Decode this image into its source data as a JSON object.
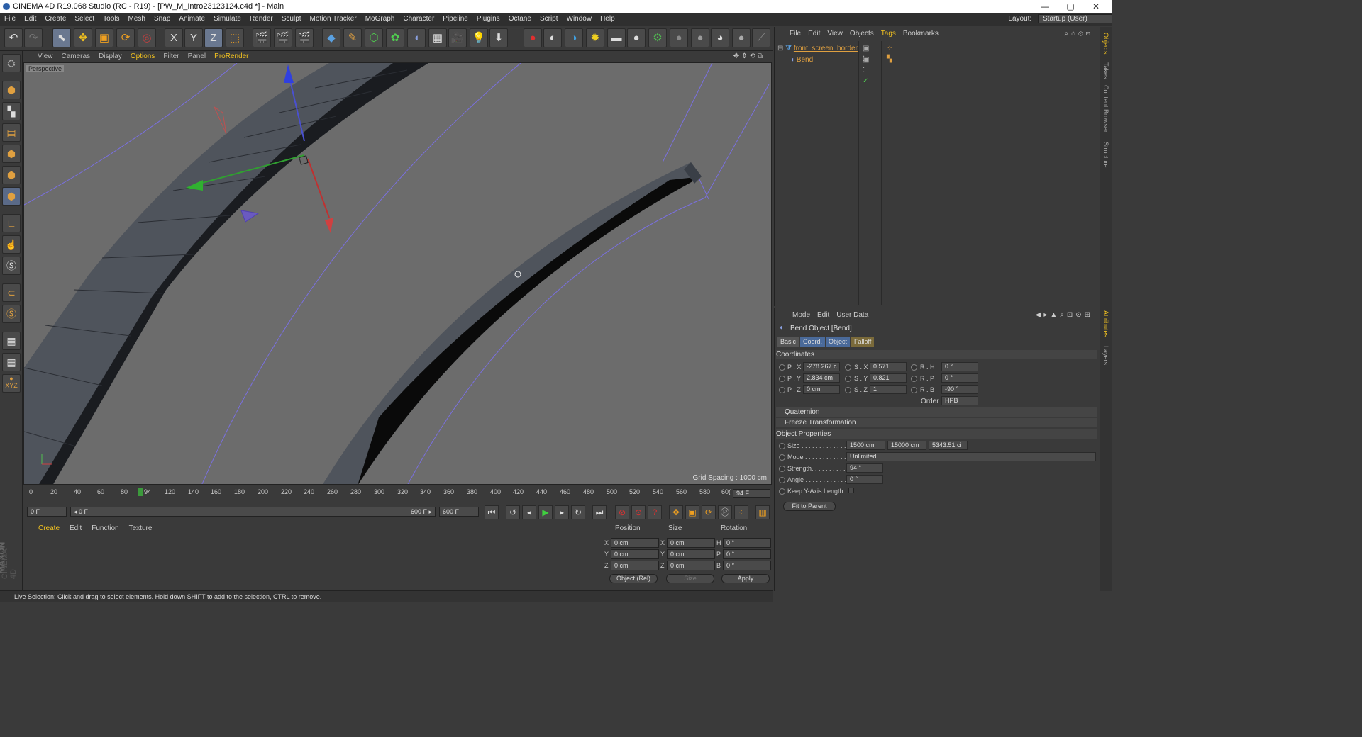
{
  "window": {
    "title": "CINEMA 4D R19.068 Studio (RC - R19) - [PW_M_Intro23123124.c4d *] - Main",
    "minimize": "—",
    "maximize": "▢",
    "close": "✕"
  },
  "menubar": {
    "items": [
      "File",
      "Edit",
      "Create",
      "Select",
      "Tools",
      "Mesh",
      "Snap",
      "Animate",
      "Simulate",
      "Render",
      "Sculpt",
      "Motion Tracker",
      "MoGraph",
      "Character",
      "Pipeline",
      "Plugins",
      "Octane",
      "Script",
      "Window",
      "Help"
    ],
    "layout_label": "Layout:",
    "layout_value": "Startup (User)"
  },
  "viewport": {
    "menu": [
      "View",
      "Cameras",
      "Display",
      "Options",
      "Filter",
      "Panel"
    ],
    "prorender": "ProRender",
    "label": "Perspective",
    "grid_spacing": "Grid Spacing : 1000 cm",
    "nav_icons": "✥⇕⟲⧉"
  },
  "timeline": {
    "ticks": [
      "0",
      "20",
      "40",
      "60",
      "80",
      "120",
      "140",
      "160",
      "180",
      "200",
      "220",
      "240",
      "260",
      "280",
      "300",
      "320",
      "340",
      "360",
      "380",
      "400",
      "420",
      "440",
      "460",
      "480",
      "500",
      "520",
      "540",
      "560",
      "580",
      "60("
    ],
    "current": "94",
    "current_frame_field": "94 F",
    "start_field": "0 F",
    "range_start": "◂ 0 F",
    "range_end": "600 F ▸",
    "end_field": "600 F"
  },
  "material_manager": {
    "menu": [
      "Create",
      "Edit",
      "Function",
      "Texture"
    ]
  },
  "coord_manager": {
    "headers": [
      "Position",
      "Size",
      "Rotation"
    ],
    "rows": [
      {
        "a": "X",
        "pos": "0 cm",
        "b": "X",
        "size": "0 cm",
        "c": "H",
        "rot": "0 °"
      },
      {
        "a": "Y",
        "pos": "0 cm",
        "b": "Y",
        "size": "0 cm",
        "c": "P",
        "rot": "0 °"
      },
      {
        "a": "Z",
        "pos": "0 cm",
        "b": "Z",
        "size": "0 cm",
        "c": "B",
        "rot": "0 °"
      }
    ],
    "mode": "Object (Rel)",
    "size_mode": "Size",
    "apply": "Apply"
  },
  "object_manager": {
    "menu": [
      "File",
      "Edit",
      "View",
      "Objects"
    ],
    "tags_label": "Tags",
    "bookmarks_label": "Bookmarks",
    "objects": [
      {
        "name": "front_screen_border",
        "color": "#e0a040"
      },
      {
        "name": "Bend",
        "color": "#e0a040"
      }
    ]
  },
  "attribute_manager": {
    "menu": [
      "Mode",
      "Edit",
      "User Data"
    ],
    "title": "Bend Object [Bend]",
    "tabs": [
      "Basic",
      "Coord.",
      "Object",
      "Falloff"
    ],
    "coordinates_label": "Coordinates",
    "coords": [
      {
        "p_lbl": "P . X",
        "p": "-278.267 c",
        "s_lbl": "S . X",
        "s": "0.571",
        "r_lbl": "R . H",
        "r": "0 °"
      },
      {
        "p_lbl": "P . Y",
        "p": "2.834 cm",
        "s_lbl": "S . Y",
        "s": "0.821",
        "r_lbl": "R . P",
        "r": "0 °"
      },
      {
        "p_lbl": "P . Z",
        "p": "0 cm",
        "s_lbl": "S . Z",
        "s": "1",
        "r_lbl": "R . B",
        "r": "-90 °"
      }
    ],
    "order_label": "Order",
    "order_value": "HPB",
    "quaternion": "Quaternion",
    "freeze": "Freeze Transformation",
    "object_props": "Object Properties",
    "size_label": "Size . . . . . . . . . . . . .",
    "size_values": [
      "1500 cm",
      "15000 cm",
      "5343.51 ci"
    ],
    "mode_label": "Mode . . . . . . . . . . . .",
    "mode_value": "Unlimited",
    "strength_label": "Strength. . . . . . . . . .",
    "strength_value": "94 °",
    "angle_label": "Angle . . . . . . . . . . . .",
    "angle_value": "0 °",
    "keep_y_label": "Keep Y-Axis Length",
    "fit_button": "Fit to Parent"
  },
  "side_tabs": [
    "Objects",
    "Takes",
    "Content Browser",
    "Structure"
  ],
  "side_tabs_lower": [
    "Attributes",
    "Layers"
  ],
  "status": "Live Selection: Click and drag to select elements. Hold down SHIFT to add to the selection, CTRL to remove.",
  "brand": {
    "maxon": "MAXON",
    "cinema": "CINEMA 4D"
  },
  "colors": {
    "accent": "#f0c020",
    "object": "#e0a040",
    "selected_tab": "#4a6a9a"
  }
}
